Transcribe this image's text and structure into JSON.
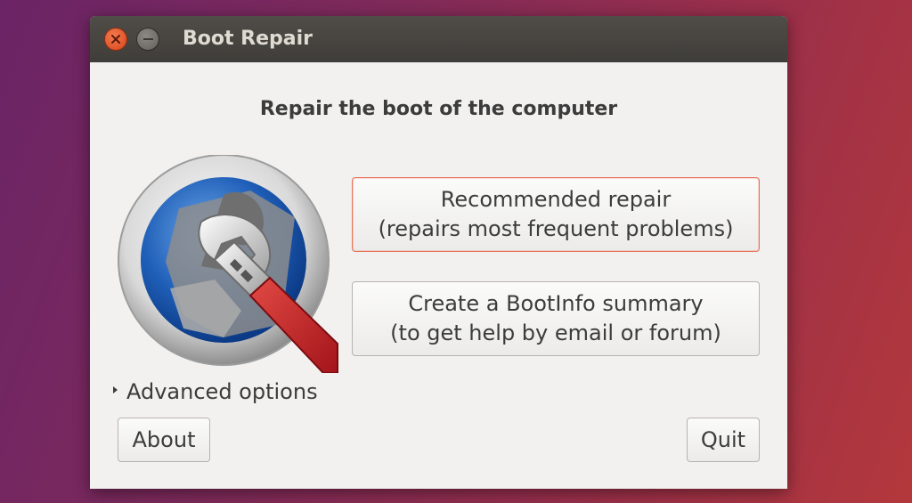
{
  "window": {
    "title": "Boot Repair",
    "controls": {
      "close": "close-icon",
      "minimize": "minimize-icon"
    }
  },
  "main": {
    "heading": "Repair the boot of the computer",
    "logo_icon": "boot-repair-logo-icon",
    "recommended": {
      "line1": "Recommended repair",
      "line2": "(repairs most frequent problems)"
    },
    "bootinfo": {
      "line1": "Create a BootInfo summary",
      "line2": "(to get help by email or forum)"
    },
    "advanced_label": "Advanced options"
  },
  "footer": {
    "about_label": "About",
    "quit_label": "Quit"
  },
  "colors": {
    "accent": "#e0542a",
    "titlebar": "#3f3d39",
    "window_bg": "#f2f1f0",
    "primary_border": "#e8735a"
  }
}
